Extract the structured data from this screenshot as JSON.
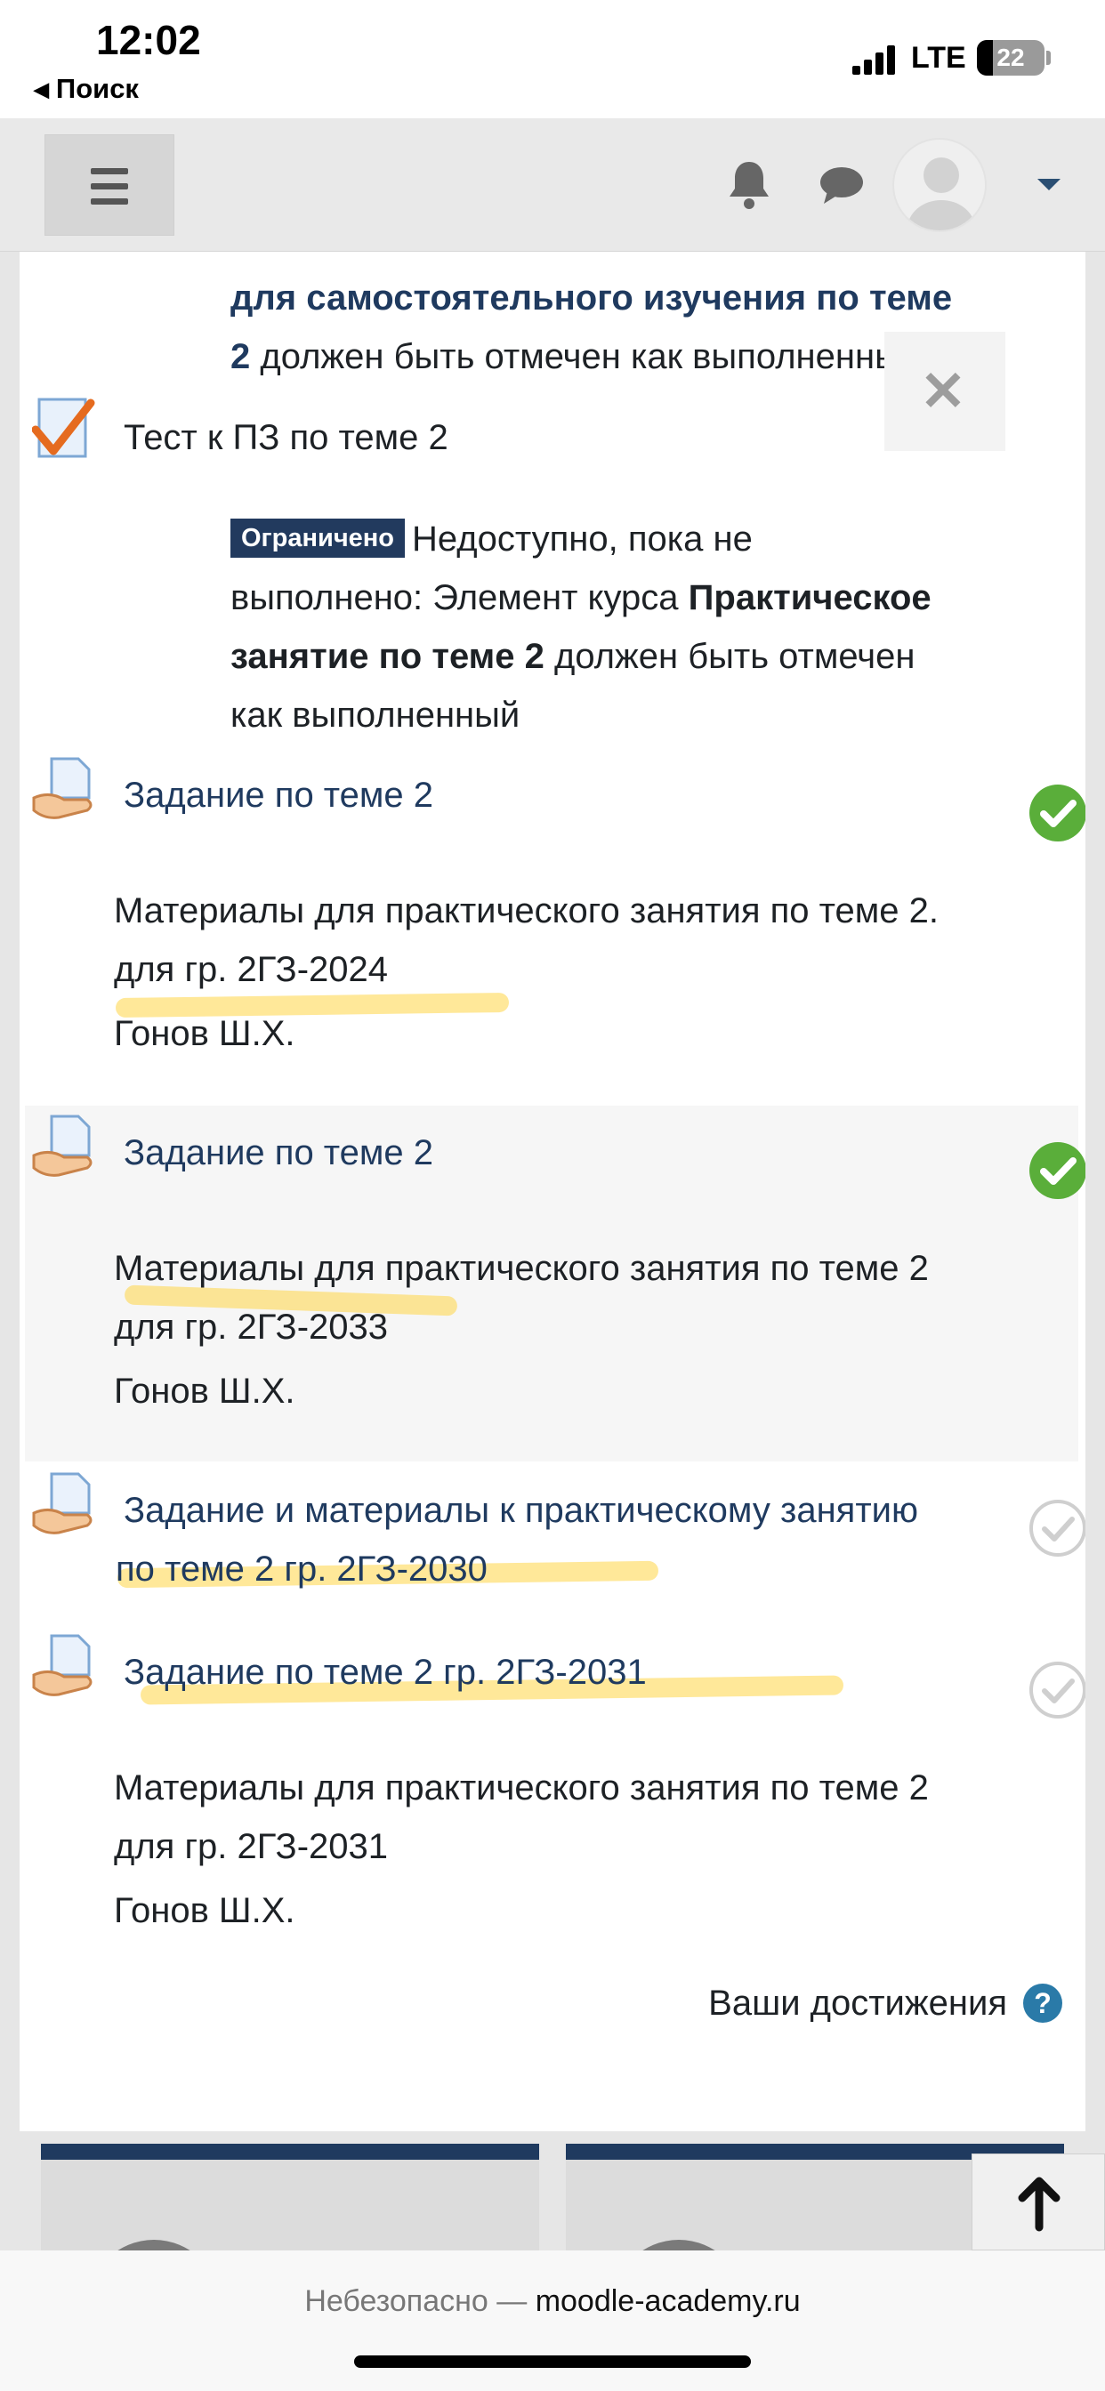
{
  "status": {
    "time": "12:02",
    "back_label": "Поиск",
    "network": "LTE",
    "battery": "22"
  },
  "navbar": {
    "menu_icon": "hamburger-menu-icon",
    "bell_icon": "bell-icon",
    "chat_icon": "chat-bubble-icon",
    "avatar_icon": "user-avatar-icon"
  },
  "course": {
    "restriction_top": {
      "line1_bold": "для самостоятельного изучения по теме",
      "line2_bold": "2",
      "line2_rest": " должен быть отмечен как выполненный"
    },
    "quiz": {
      "title": "Тест к ПЗ по теме 2",
      "badge": "Ограничено",
      "text_line1": "Недоступно, пока не",
      "text_line2_a": "выполнено: Элемент курса ",
      "text_line2_b": "Практическое",
      "text_line3_a": "занятие по теме 2",
      "text_line3_b": " должен быть отмечен",
      "text_line4": "как выполненный"
    },
    "activities": [
      {
        "title": "Задание по теме 2",
        "desc_line1": "Материалы для практического занятия по теме 2.",
        "desc_line2": "для гр. 2ГЗ-2024",
        "author": "Гонов Ш.Х.",
        "completed": true
      },
      {
        "title": "Задание по теме 2",
        "desc_line1": "Материалы для практического занятия по теме 2",
        "desc_line2": "для гр. 2ГЗ-2033",
        "author": "Гонов Ш.Х.",
        "completed": true
      },
      {
        "title_line1": "Задание и материалы к практическому занятию",
        "title_line2": "по теме 2 гр. 2ГЗ-2030",
        "completed": false
      },
      {
        "title": "Задание по теме 2 гр. 2ГЗ-2031",
        "desc_line1": "Материалы для практического занятия по теме 2",
        "desc_line2": "для гр. 2ГЗ-2031",
        "author": "Гонов Ш.Х.",
        "completed": false
      }
    ],
    "achievements_label": "Ваши достижения",
    "help_glyph": "?"
  },
  "browser": {
    "insecure_label": "Небезопасно — ",
    "domain": "moodle-academy.ru"
  },
  "colors": {
    "link": "#1f3a5f",
    "badge": "#223a5e",
    "complete_green": "#5aae3a",
    "highlight": "#ffd646"
  }
}
